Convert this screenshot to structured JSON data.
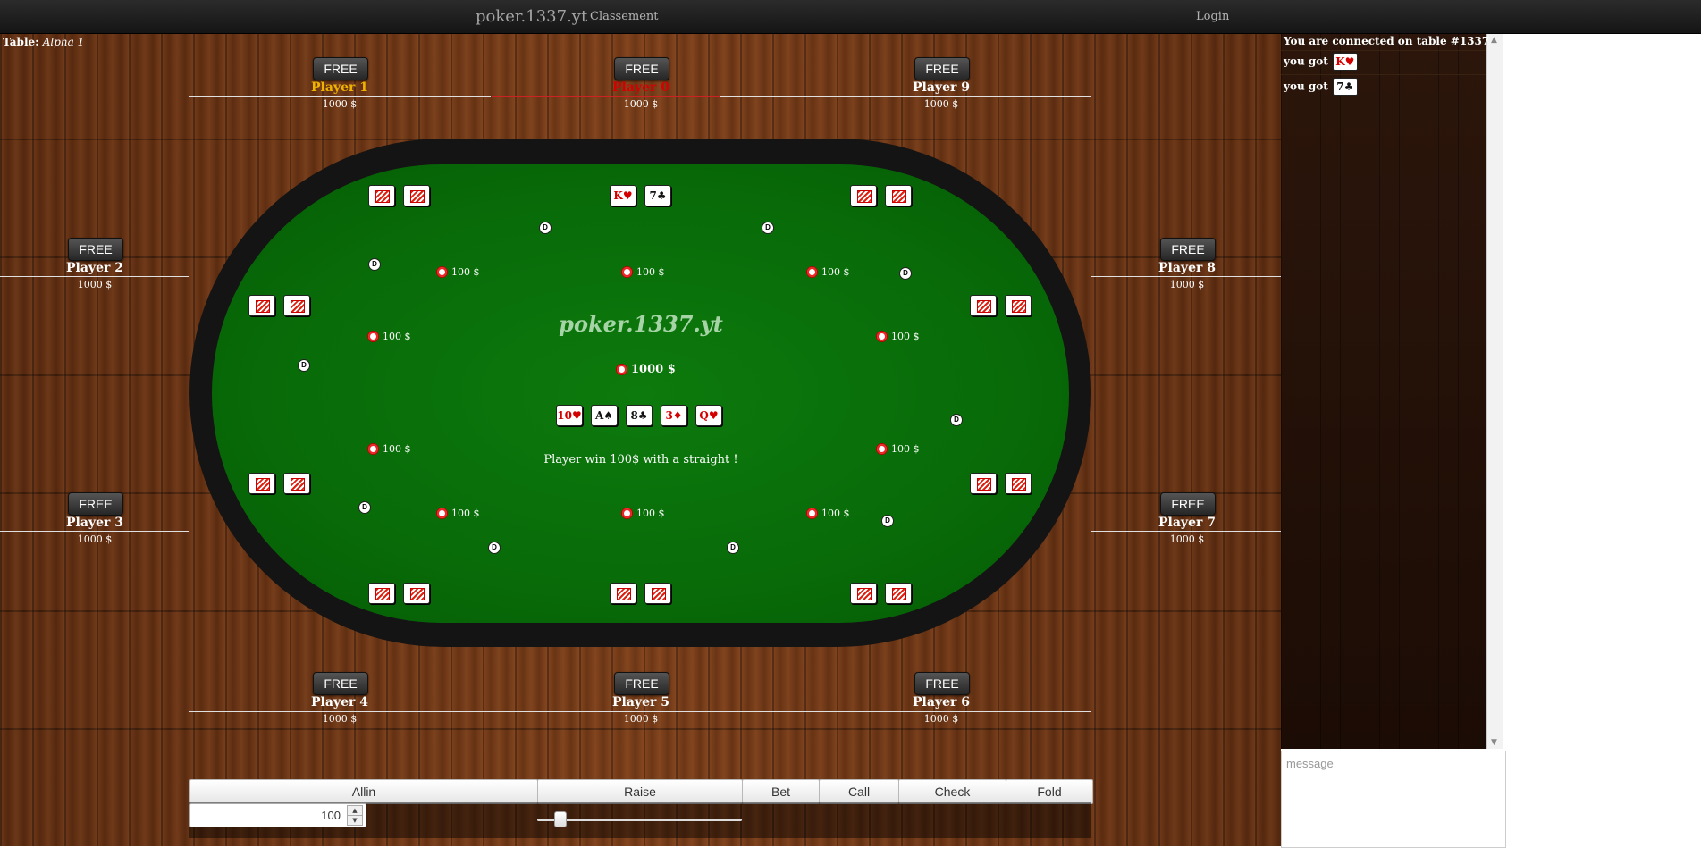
{
  "nav": {
    "brand": "poker.1337.yt",
    "classement": "Classement",
    "login": "Login"
  },
  "table": {
    "label": "Table:",
    "name": "Alpha 1",
    "logo": "poker.1337.yt",
    "winner_message": "Player win 100$ with a straight !",
    "pot": "1000 $"
  },
  "seats": [
    {
      "free": "FREE",
      "name": "Player 0",
      "stack": "1000 $",
      "name_color": "#d40000"
    },
    {
      "free": "FREE",
      "name": "Player 1",
      "stack": "1000 $",
      "name_color": "#f0b400"
    },
    {
      "free": "FREE",
      "name": "Player 2",
      "stack": "1000 $",
      "name_color": "#ffffff"
    },
    {
      "free": "FREE",
      "name": "Player 3",
      "stack": "1000 $",
      "name_color": "#ffffff"
    },
    {
      "free": "FREE",
      "name": "Player 4",
      "stack": "1000 $",
      "name_color": "#ffffff"
    },
    {
      "free": "FREE",
      "name": "Player 5",
      "stack": "1000 $",
      "name_color": "#ffffff"
    },
    {
      "free": "FREE",
      "name": "Player 6",
      "stack": "1000 $",
      "name_color": "#ffffff"
    },
    {
      "free": "FREE",
      "name": "Player 7",
      "stack": "1000 $",
      "name_color": "#ffffff"
    },
    {
      "free": "FREE",
      "name": "Player 8",
      "stack": "1000 $",
      "name_color": "#ffffff"
    },
    {
      "free": "FREE",
      "name": "Player 9",
      "stack": "1000 $",
      "name_color": "#ffffff"
    }
  ],
  "hero_cards": [
    {
      "text": "K♥",
      "color": "red"
    },
    {
      "text": "7♣",
      "color": "black"
    }
  ],
  "community_cards": [
    {
      "text": "10♥",
      "color": "red"
    },
    {
      "text": "A♠",
      "color": "black"
    },
    {
      "text": "8♣",
      "color": "black"
    },
    {
      "text": "3♦",
      "color": "red"
    },
    {
      "text": "Q♥",
      "color": "red"
    }
  ],
  "bets": [
    "100 $",
    "100 $",
    "100 $",
    "100 $",
    "100 $",
    "100 $",
    "100 $",
    "100 $",
    "100 $",
    "100 $"
  ],
  "dealer_label": "D",
  "controls": {
    "allin": "Allin",
    "raise": "Raise",
    "bet": "Bet",
    "call": "Call",
    "check": "Check",
    "fold": "Fold",
    "amount": "100",
    "spin_up": "▲",
    "spin_down": "▼",
    "slider_fraction": 0.09
  },
  "chat": {
    "connected": "You are connected on table #1337",
    "messages": [
      {
        "text": "you got",
        "card": "K♥",
        "color": "red"
      },
      {
        "text": "you got",
        "card": "7♣",
        "color": "black"
      }
    ],
    "placeholder": "message",
    "scroll_up": "▲",
    "scroll_down": "▼"
  },
  "colors": {
    "felt": "#086b08",
    "rail": "#141414",
    "wood": "#6b3414",
    "navbar": "#1c1c1c"
  }
}
